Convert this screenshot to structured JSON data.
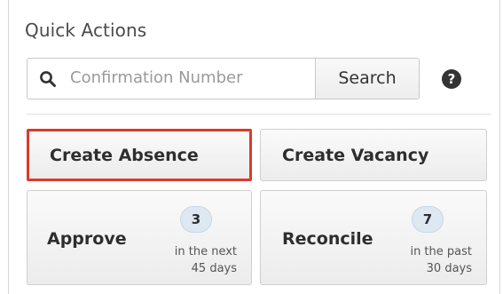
{
  "panel": {
    "title": "Quick Actions"
  },
  "search": {
    "icon": "search-icon",
    "placeholder": "Confirmation Number",
    "button_label": "Search",
    "help_icon": "question-circle-icon",
    "help_glyph": "?"
  },
  "actions": {
    "create_absence": {
      "label": "Create Absence",
      "highlight_color": "#dc3a2a"
    },
    "create_vacancy": {
      "label": "Create Vacancy"
    },
    "approve": {
      "label": "Approve",
      "count": "3",
      "caption_line1": "in the next",
      "caption_line2": "45 days"
    },
    "reconcile": {
      "label": "Reconcile",
      "count": "7",
      "caption_line1": "in the past",
      "caption_line2": "30 days"
    }
  },
  "colors": {
    "badge_background": "#dde8f3",
    "button_background": "#f3f3f3",
    "border": "#cfcfcf"
  }
}
